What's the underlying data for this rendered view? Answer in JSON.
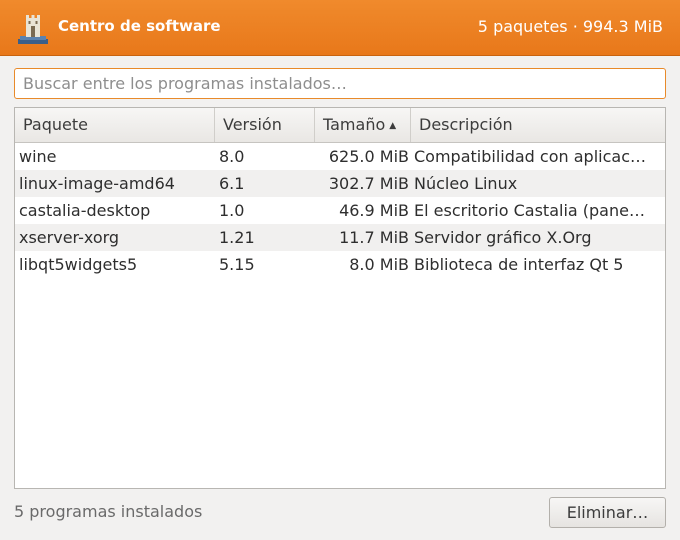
{
  "header": {
    "title": "Centro de software",
    "summary": "5 paquetes · 994.3 MiB",
    "icon": "app-castle-icon"
  },
  "search": {
    "placeholder": "Buscar entre los programas instalados…",
    "value": ""
  },
  "table": {
    "columns": [
      "Paquete",
      "Versión",
      "Tamaño",
      "Descripción"
    ],
    "sort": {
      "column": "Tamaño",
      "direction": "ascending-indicator",
      "icon": "sort-up-icon"
    },
    "rows": [
      [
        "wine",
        "8.0",
        "625.0 MiB",
        "Compatibilidad con aplicac…"
      ],
      [
        "linux-image-amd64",
        "6.1",
        "302.7 MiB",
        "Núcleo Linux"
      ],
      [
        "castalia-desktop",
        "1.0",
        "46.9 MiB",
        "El escritorio Castalia (pane…"
      ],
      [
        "xserver-xorg",
        "1.21",
        "11.7 MiB",
        "Servidor gráfico X.Org"
      ],
      [
        "libqt5widgets5",
        "5.15",
        "8.0 MiB",
        "Biblioteca de interfaz Qt 5"
      ]
    ]
  },
  "footer": {
    "status": "5 programas instalados",
    "remove_label": "Eliminar…"
  },
  "colors": {
    "accent": "#ee8426",
    "row_alt": "#f1f0ef"
  }
}
